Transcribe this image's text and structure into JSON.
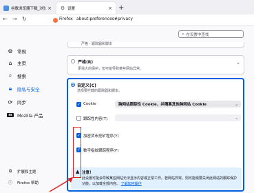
{
  "tabs": [
    {
      "label": "谷歌浏览器下载_浏览器官网入口",
      "close": "×"
    },
    {
      "label": "设置",
      "close": "×"
    }
  ],
  "new_tab": "+",
  "nav": {
    "back": "←",
    "forward": "→",
    "reload": "↻",
    "brand": "Firefox",
    "url": "about:preferences#privacy"
  },
  "search": {
    "placeholder": "在设置中查找"
  },
  "sidebar": {
    "items": [
      {
        "label": "常规",
        "icon": "gear-icon"
      },
      {
        "label": "主页",
        "icon": "home-icon"
      },
      {
        "label": "搜索",
        "icon": "search-icon"
      },
      {
        "label": "隐私与安全",
        "icon": "lock-icon"
      },
      {
        "label": "同步",
        "icon": "sync-icon"
      },
      {
        "label": "Mozilla 产品",
        "icon": "mozilla-icon"
      }
    ],
    "footer": [
      {
        "label": "扩展和主题",
        "icon": "puzzle-icon"
      },
      {
        "label": "Firefox 帮助",
        "icon": "help-icon"
      }
    ]
  },
  "panel": {
    "top_cut_text": "严格 - 跟踪器和脚本",
    "strict": {
      "title": "严格(R)",
      "desc": "更强大的保护，但可能导致某些网站异常。"
    },
    "custom": {
      "title": "自定义(C)",
      "desc": "选择要拦截的跟踪器和脚本。",
      "options": [
        {
          "label": "Cookie",
          "checked": true,
          "select": "跨网站跟踪性 Cookie，并隔离其他跨网站 Cookie"
        },
        {
          "label": "跟踪性内容(T)",
          "checked": false,
          "select": ""
        },
        {
          "label": "加密货币挖矿程序(Y)",
          "checked": true
        },
        {
          "label": "数字指纹跟踪程序(F)",
          "checked": true
        }
      ],
      "warning": {
        "title": "注意！",
        "body": "此设置可能会导致某些网站无法显示内容或正常工作。若网站异常，则可能需要关闭此网站的跟踪保护功能，以加载全部内容。",
        "link": "了解如何操作"
      }
    }
  },
  "colors": {
    "accent": "#0061e0",
    "annotation": "#e02020",
    "warning_bg": "#e0f0ff"
  }
}
